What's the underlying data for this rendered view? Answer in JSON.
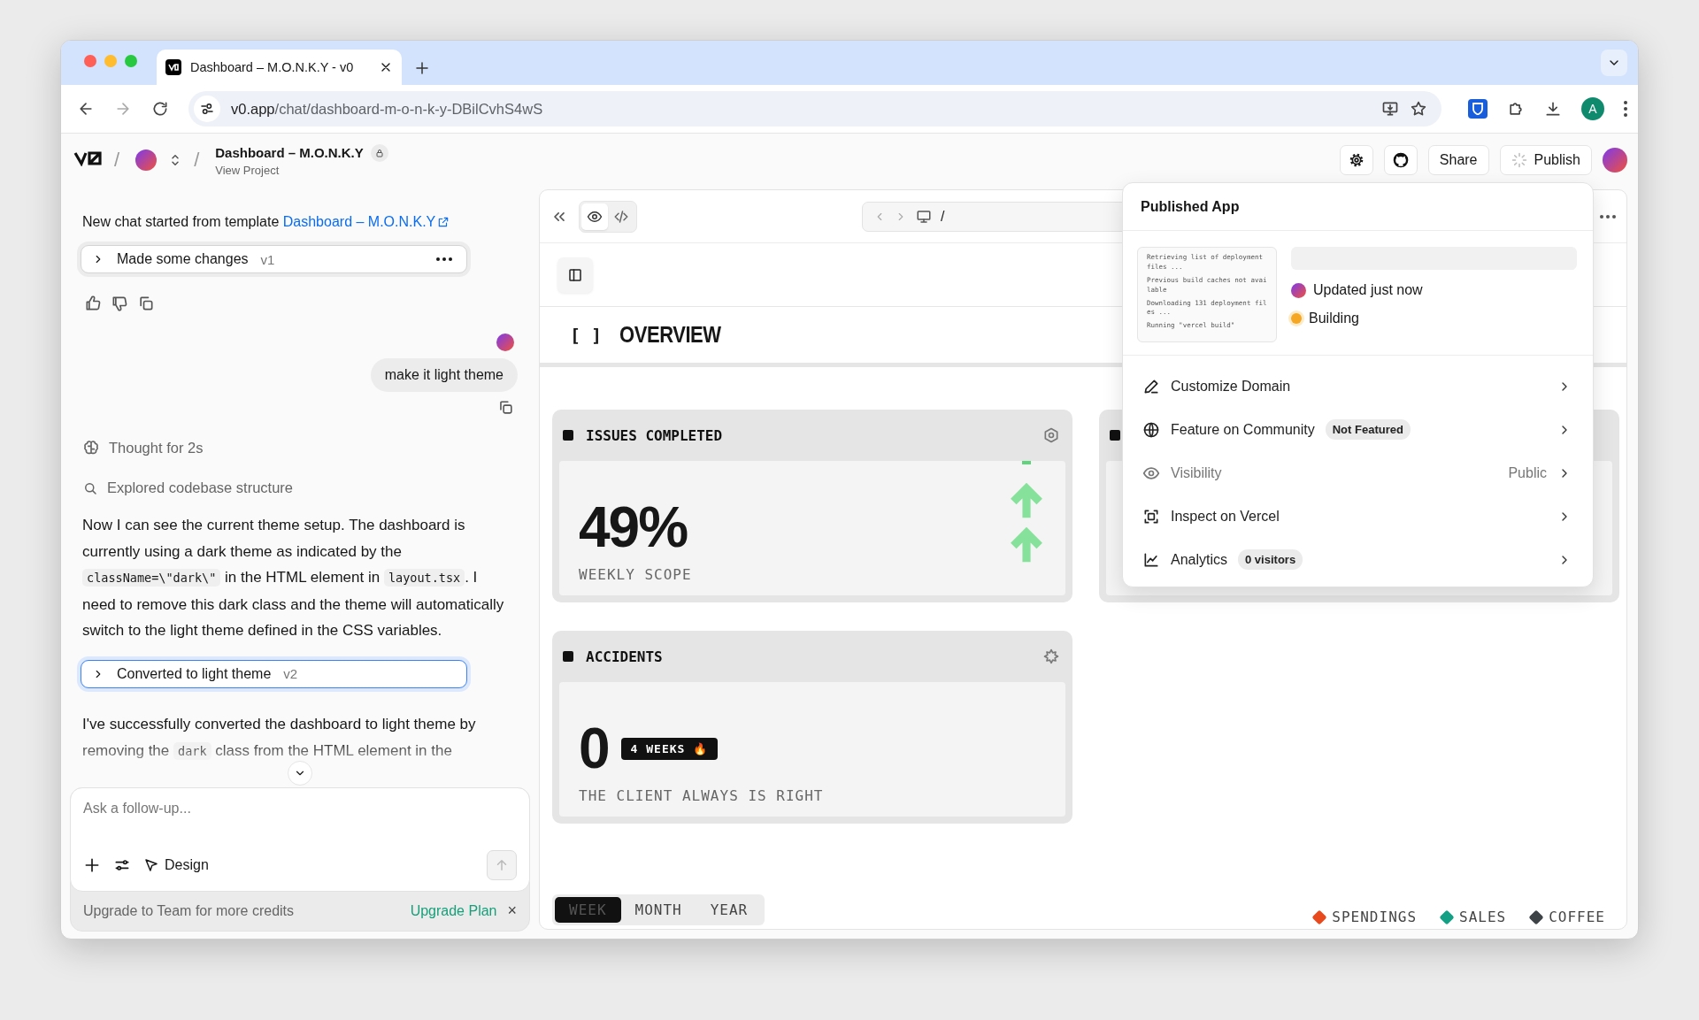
{
  "browser": {
    "tab_title": "Dashboard – M.O.N.K.Y - v0",
    "url_host": "v0.app",
    "url_path": "/chat/dashboard-m-o-n-k-y-DBilCvhS4wS",
    "profile_initial": "A"
  },
  "header": {
    "separators": [
      "/",
      "/"
    ],
    "project_title": "Dashboard – M.O.N.K.Y",
    "project_link": "View Project",
    "share_label": "Share",
    "publish_label": "Publish"
  },
  "chat": {
    "items": [
      {
        "kind": "intro",
        "text": "New chat started from template",
        "link": "Dashboard – M.O.N.K.Y"
      },
      {
        "kind": "version",
        "title": "Made some changes",
        "tag": "v1",
        "selected": false
      },
      {
        "kind": "feedback"
      },
      {
        "kind": "user_message",
        "text": "make it light theme"
      },
      {
        "kind": "thought",
        "text": "Thought for 2s"
      },
      {
        "kind": "search",
        "text": "Explored codebase structure"
      },
      {
        "kind": "paragraph",
        "faded": false,
        "segments": [
          {
            "kind": "text",
            "text": "Now I can see the current theme setup. The dashboard is currently using a dark theme as indicated by the "
          },
          {
            "kind": "code",
            "text": "className=\\\"dark\\\""
          },
          {
            "kind": "text",
            "text": " in the HTML element in "
          },
          {
            "kind": "code",
            "text": "layout.tsx"
          },
          {
            "kind": "text",
            "text": ". I need to remove this dark class and the theme will automatically switch to the light theme defined in the CSS variables."
          }
        ]
      },
      {
        "kind": "version",
        "title": "Converted to light theme",
        "tag": "v2",
        "selected": true
      },
      {
        "kind": "paragraph",
        "faded": true,
        "segments": [
          {
            "kind": "text",
            "text": "I've successfully converted the dashboard to light theme by removing the "
          },
          {
            "kind": "code",
            "text": "dark"
          },
          {
            "kind": "text",
            "text": " class from the HTML element in the"
          }
        ]
      }
    ],
    "composer": {
      "placeholder": "Ask a follow-up...",
      "design_label": "Design"
    },
    "upgrade": {
      "text": "Upgrade to Team for more credits",
      "link": "Upgrade Plan",
      "close": "×"
    }
  },
  "preview": {
    "view_toggle": [
      {
        "kind": "preview",
        "selected": true
      },
      {
        "kind": "code",
        "selected": false
      }
    ],
    "path": "/",
    "section_bracket": "[ ]",
    "section_title": "OVERVIEW",
    "cards": [
      {
        "kind": "issues",
        "title": "ISSUES COMPLETED",
        "value": "49%",
        "caption": "WEEKLY SCOPE"
      },
      {
        "kind": "obscured"
      },
      {
        "kind": "accidents",
        "title": "ACCIDENTS",
        "value": "0",
        "badge": "4 WEEKS 🔥",
        "caption": "THE CLIENT ALWAYS IS RIGHT"
      }
    ],
    "range_tabs": [
      {
        "label": "WEEK",
        "selected": true
      },
      {
        "label": "MONTH",
        "selected": false
      },
      {
        "label": "YEAR",
        "selected": false
      }
    ],
    "legend": [
      {
        "label": "SPENDINGS",
        "color": "#e8491d"
      },
      {
        "label": "SALES",
        "color": "#14a085"
      },
      {
        "label": "COFFEE",
        "color": "#3d4347"
      }
    ]
  },
  "popup": {
    "title": "Published App",
    "log_lines": [
      "Retrieving list of deployment files ...",
      "Previous build caches not available",
      "Downloading 131 deployment files ...",
      "Running \"vercel build\""
    ],
    "status": [
      {
        "kind": "updated",
        "text": "Updated just now"
      },
      {
        "kind": "building",
        "text": "Building",
        "color": "#f5a623"
      }
    ],
    "menu": [
      {
        "kind": "domain",
        "label": "Customize Domain",
        "dimmed": false
      },
      {
        "kind": "community",
        "label": "Feature on Community",
        "badge": "Not Featured",
        "dimmed": false
      },
      {
        "kind": "visibility",
        "label": "Visibility",
        "value": "Public",
        "dimmed": true
      },
      {
        "kind": "inspect",
        "label": "Inspect on Vercel",
        "dimmed": false
      },
      {
        "kind": "analytics",
        "label": "Analytics",
        "badge": "0 visitors",
        "dimmed": false
      }
    ]
  }
}
